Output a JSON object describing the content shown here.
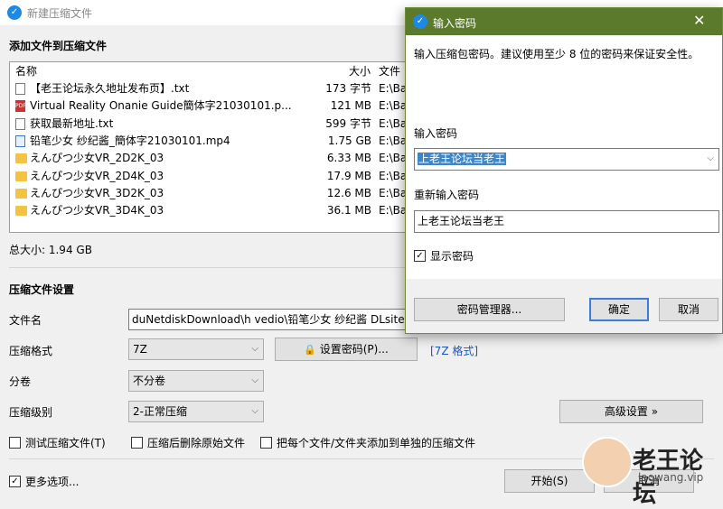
{
  "window": {
    "title": "新建压缩文件"
  },
  "add_section": {
    "heading": "添加文件到压缩文件"
  },
  "file_list": {
    "headers": {
      "name": "名称",
      "size": "大小",
      "path": "文件"
    },
    "rows": [
      {
        "icon": "text-file-icon",
        "name": "【老王论坛永久地址发布页】.txt",
        "size": "173 字节",
        "path": "E:\\Ba"
      },
      {
        "icon": "pdf-file-icon",
        "name": "Virtual Reality Onanie Guide簡体字21030101.p...",
        "size": "121 MB",
        "path": "E:\\Ba"
      },
      {
        "icon": "text-file-icon",
        "name": "获取最新地址.txt",
        "size": "599 字节",
        "path": "E:\\Ba"
      },
      {
        "icon": "video-file-icon",
        "name": "铅笔少女 纱纪酱_簡体字21030101.mp4",
        "size": "1.75 GB",
        "path": "E:\\Ba"
      },
      {
        "icon": "folder-icon",
        "name": "えんぴつ少女VR_2D2K_03",
        "size": "6.33 MB",
        "path": "E:\\Ba"
      },
      {
        "icon": "folder-icon",
        "name": "えんぴつ少女VR_2D4K_03",
        "size": "17.9 MB",
        "path": "E:\\Ba"
      },
      {
        "icon": "folder-icon",
        "name": "えんぴつ少女VR_3D2K_03",
        "size": "12.6 MB",
        "path": "E:\\Ba"
      },
      {
        "icon": "folder-icon",
        "name": "えんぴつ少女VR_3D4K_03",
        "size": "36.1 MB",
        "path": "E:\\Ba"
      }
    ],
    "total": "总大小: 1.94 GB"
  },
  "settings": {
    "heading": "压缩文件设置",
    "filename_label": "文件名",
    "filename_value": "duNetdiskDownload\\h vedio\\铅笔少女 纱纪酱 DLsite官",
    "format_label": "压缩格式",
    "format_value": "7Z",
    "set_password_button": "设置密码(P)...",
    "format_link": "[7Z 格式]",
    "split_label": "分卷",
    "split_value": "不分卷",
    "level_label": "压缩级别",
    "level_value": "2-正常压缩",
    "advanced_button": "高级设置 »",
    "test_checkbox": "测试压缩文件(T)",
    "delete_checkbox": "压缩后删除原始文件",
    "each_checkbox": "把每个文件/文件夹添加到单独的压缩文件",
    "more_options": "更多选项...",
    "start_button": "开始(S)",
    "cancel_button": "取消"
  },
  "password_dialog": {
    "title": "输入密码",
    "description": "输入压缩包密码。建议使用至少 8 位的密码来保证安全性。",
    "password_label": "输入密码",
    "password_value": "上老王论坛当老王",
    "repeat_label": "重新输入密码",
    "repeat_value": "上老王论坛当老王",
    "show_password": "显示密码",
    "manager_button": "密码管理器...",
    "ok_button": "确定",
    "cancel_button": "取消"
  },
  "watermark": {
    "brand": "老王论坛",
    "domain": "laowang.vip"
  }
}
